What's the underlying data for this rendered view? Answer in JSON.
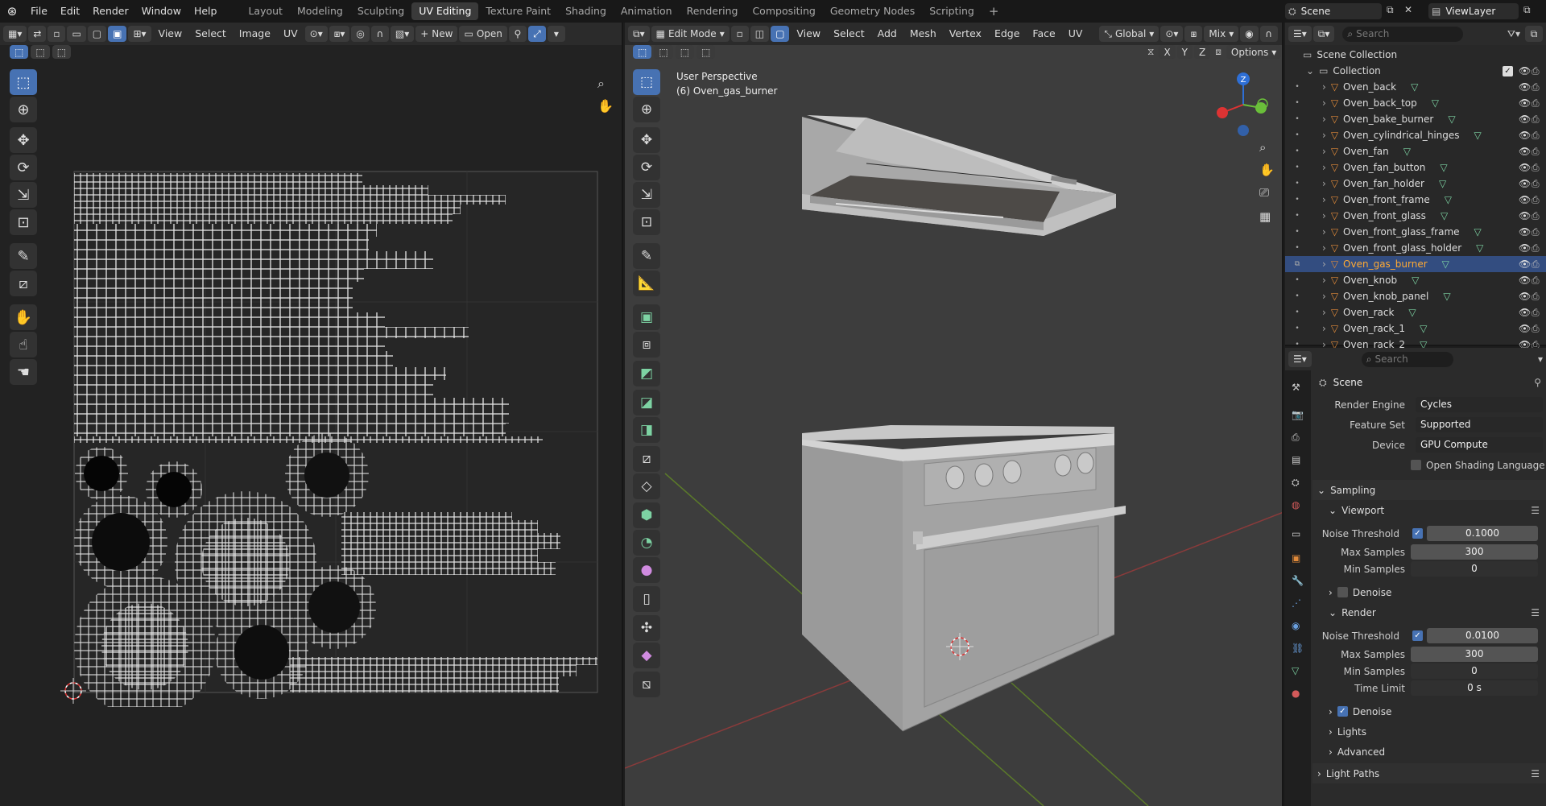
{
  "topbar": {
    "menus": [
      "File",
      "Edit",
      "Render",
      "Window",
      "Help"
    ],
    "workspaces": [
      "Layout",
      "Modeling",
      "Sculpting",
      "UV Editing",
      "Texture Paint",
      "Shading",
      "Animation",
      "Rendering",
      "Compositing",
      "Geometry Nodes",
      "Scripting"
    ],
    "active_workspace": "UV Editing",
    "scene": "Scene",
    "view_layer": "ViewLayer"
  },
  "uv_editor": {
    "menus": [
      "View",
      "Select",
      "Image",
      "UV"
    ],
    "new_label": "New",
    "open_label": "Open"
  },
  "viewport": {
    "mode": "Edit Mode",
    "menus": [
      "View",
      "Select",
      "Add",
      "Mesh",
      "Vertex",
      "Edge",
      "Face",
      "UV"
    ],
    "transform_orientation": "Global",
    "proportional": "Mix",
    "options_label": "Options",
    "axis_labels": [
      "X",
      "Y",
      "Z"
    ],
    "perspective": "User Perspective",
    "object_info": "(6) Oven_gas_burner",
    "gizmo_z": "Z"
  },
  "outliner": {
    "search_placeholder": "Search",
    "root": "Scene Collection",
    "collection": "Collection",
    "items": [
      "Oven_back",
      "Oven_back_top",
      "Oven_bake_burner",
      "Oven_cylindrical_hinges",
      "Oven_fan",
      "Oven_fan_button",
      "Oven_fan_holder",
      "Oven_front_frame",
      "Oven_front_glass",
      "Oven_front_glass_frame",
      "Oven_front_glass_holder",
      "Oven_gas_burner",
      "Oven_knob",
      "Oven_knob_panel",
      "Oven_rack",
      "Oven_rack_1",
      "Oven_rack_2"
    ],
    "selected": "Oven_gas_burner"
  },
  "properties": {
    "search_placeholder": "Search",
    "context": "Scene",
    "render_engine_label": "Render Engine",
    "render_engine": "Cycles",
    "feature_set_label": "Feature Set",
    "feature_set": "Supported",
    "device_label": "Device",
    "device": "GPU Compute",
    "osl_label": "Open Shading Language",
    "sampling": "Sampling",
    "viewport": "Viewport",
    "render": "Render",
    "noise_threshold_label": "Noise Threshold",
    "max_samples_label": "Max Samples",
    "min_samples_label": "Min Samples",
    "time_limit_label": "Time Limit",
    "denoise_label": "Denoise",
    "vp_noise_threshold": "0.1000",
    "vp_max_samples": "300",
    "vp_min_samples": "0",
    "r_noise_threshold": "0.0100",
    "r_max_samples": "300",
    "r_min_samples": "0",
    "r_time_limit": "0 s",
    "lights": "Lights",
    "advanced": "Advanced",
    "light_paths": "Light Paths"
  },
  "colors": {
    "accent": "#4772b3",
    "selection_row": "#334d80",
    "selected_text": "#ffaa33",
    "mesh_icon": "#7dd3a3"
  }
}
